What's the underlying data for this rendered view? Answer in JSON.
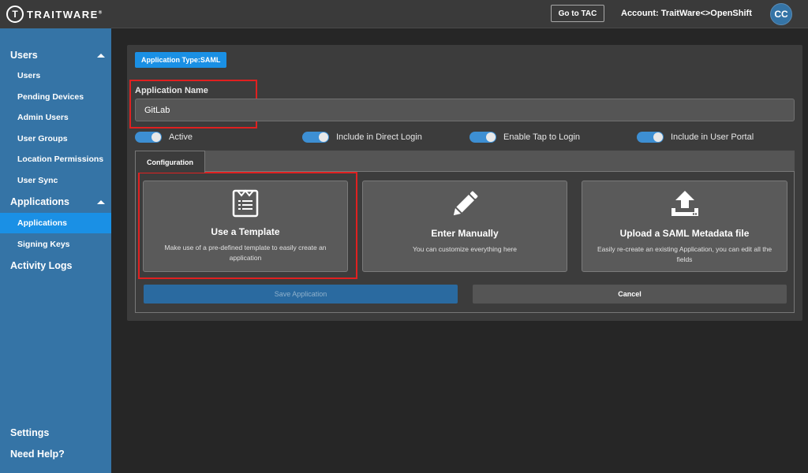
{
  "brand": {
    "logo_letter": "T",
    "name": "TRAITWARE",
    "trademark": "®"
  },
  "sidebar": {
    "sections": [
      {
        "label": "Users"
      },
      {
        "label": "Applications"
      },
      {
        "label": "Activity Logs"
      }
    ],
    "user_items": [
      {
        "label": "Users"
      },
      {
        "label": "Pending Devices"
      },
      {
        "label": "Admin Users"
      },
      {
        "label": "User Groups"
      },
      {
        "label": "Location Permissions"
      },
      {
        "label": "User Sync"
      }
    ],
    "app_items": [
      {
        "label": "Applications",
        "active": true
      },
      {
        "label": "Signing Keys"
      }
    ],
    "footer": [
      {
        "label": "Settings"
      },
      {
        "label": "Need Help?"
      }
    ]
  },
  "topbar": {
    "tac_button": "Go to TAC",
    "account_label": "Account:",
    "account_name": "TraitWare<>OpenShift",
    "avatar_initials": "CC"
  },
  "form": {
    "type_badge": "Application Type:SAML",
    "app_name_label": "Application Name",
    "app_name_value": "GitLab",
    "toggles": [
      {
        "label": "Active",
        "on": true
      },
      {
        "label": "Include in Direct Login",
        "on": true
      },
      {
        "label": "Enable Tap to Login",
        "on": true
      },
      {
        "label": "Include in User Portal",
        "on": true
      }
    ],
    "tab_label": "Configuration",
    "cards": [
      {
        "title": "Use a Template",
        "desc": "Make use of a pre-defined template to easily create an application",
        "icon": "template-icon"
      },
      {
        "title": "Enter Manually",
        "desc": "You can customize everything here",
        "icon": "pencil-icon"
      },
      {
        "title": "Upload a SAML Metadata file",
        "desc": "Easily re-create an existing Application, you can edit all the fields",
        "icon": "upload-icon"
      }
    ],
    "save_label": "Save Application",
    "cancel_label": "Cancel"
  },
  "colors": {
    "sidebar": "#3574a6",
    "active_item": "#1a90e5",
    "background": "#262626",
    "highlight_border": "#e02020"
  }
}
